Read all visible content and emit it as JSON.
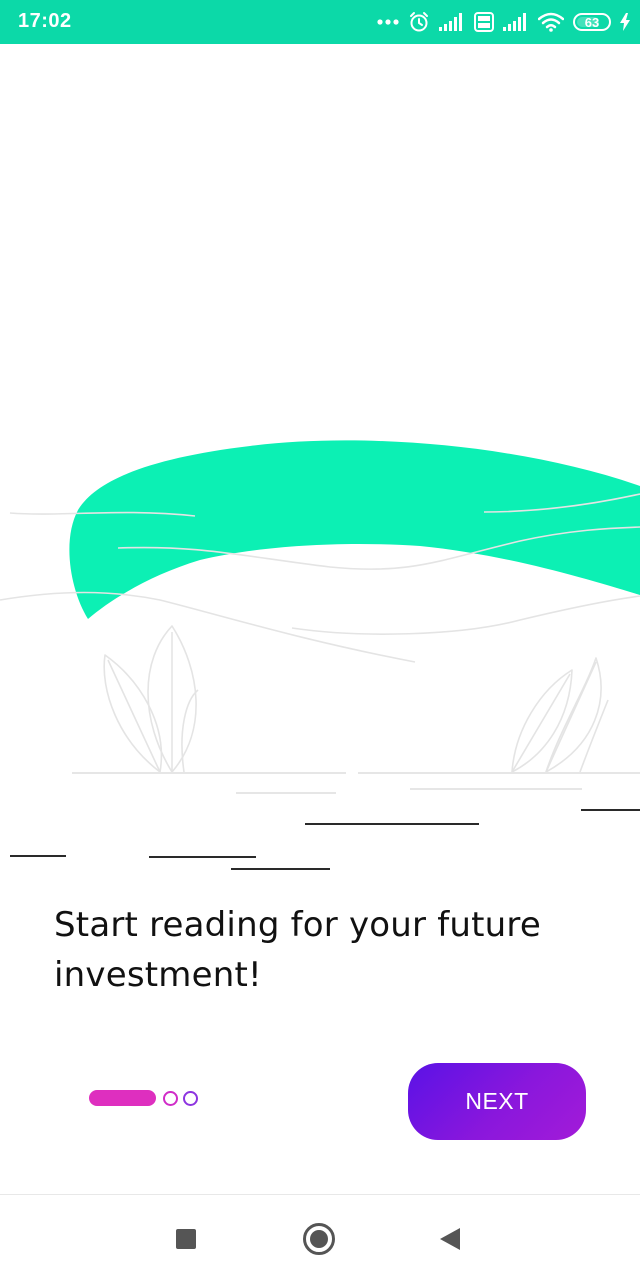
{
  "status_bar": {
    "time": "17:02",
    "battery_level": "63",
    "background_color": "#0cd9a8",
    "icons": [
      "more-dots-icon",
      "alarm-icon",
      "signal-icon",
      "volte-icon",
      "signal-icon",
      "wifi-icon",
      "battery-icon",
      "charging-icon"
    ]
  },
  "illustration": {
    "accent_color": "#0cf0b4",
    "line_color": "#e2e2e2"
  },
  "onboarding": {
    "headline": "Start reading for your future investment!",
    "page_indicator": {
      "total": 3,
      "current": 1,
      "active_color": "#de2fbf"
    },
    "next_label": "NEXT"
  },
  "nav_bar": {
    "icons": [
      "recents-icon",
      "home-icon",
      "back-icon"
    ]
  }
}
